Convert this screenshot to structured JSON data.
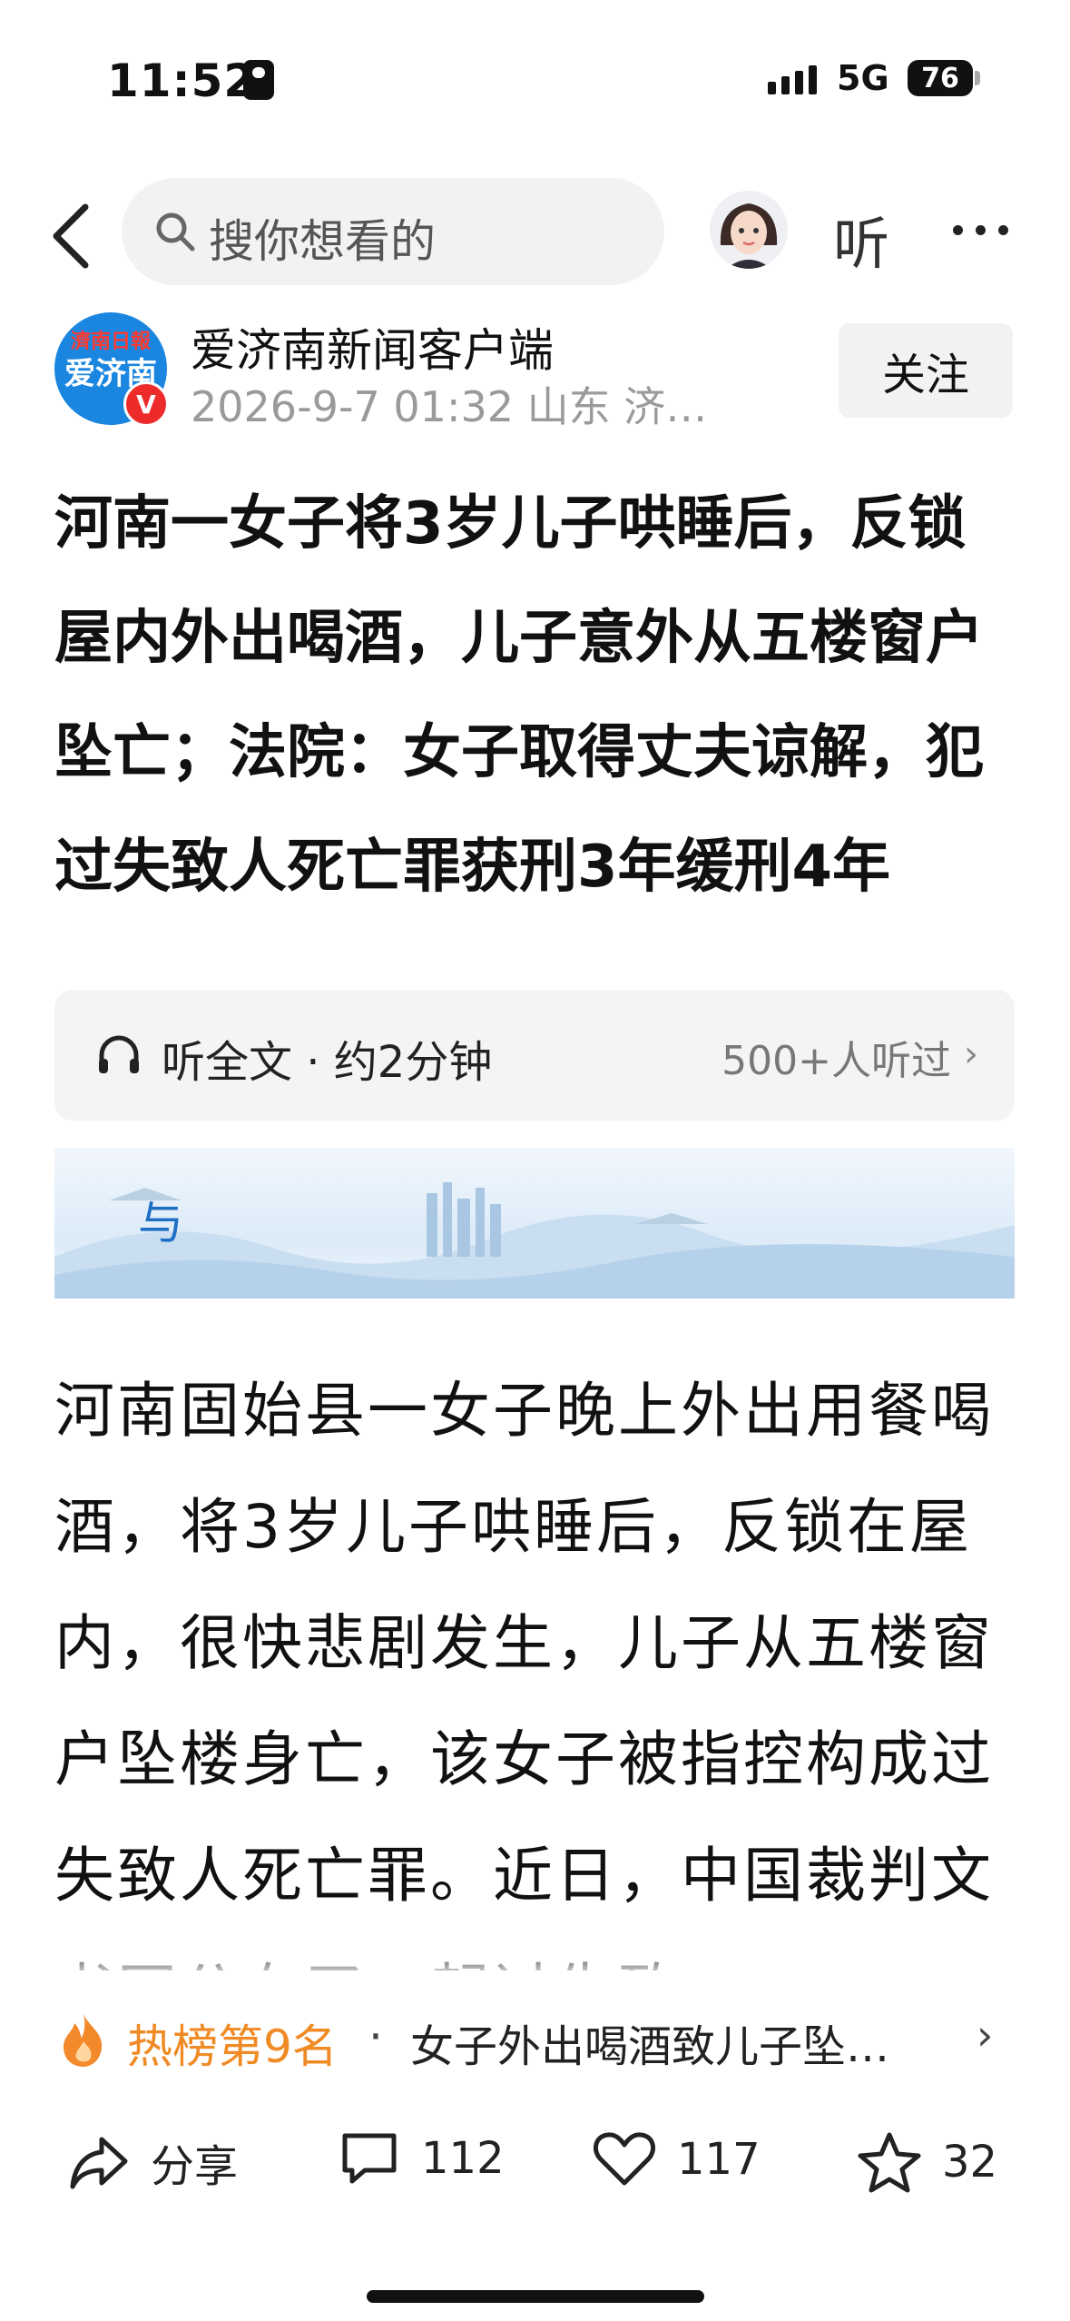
{
  "status_bar": {
    "time": "11:52",
    "network": "5G",
    "battery": "76"
  },
  "search": {
    "placeholder": "搜你想看的"
  },
  "nav": {
    "listen_label": "听"
  },
  "publisher": {
    "name": "爱济南新闻客户端",
    "meta": "2026-9-7 01:32 山东 济…",
    "logo_top": "濟南日報",
    "logo_main": "爱济南",
    "verified_badge": "V",
    "follow_label": "关注"
  },
  "article": {
    "title": "河南一女子将3岁儿子哄睡后，反锁屋内外出喝酒，儿子意外从五楼窗户坠亡；法院：女子取得丈夫谅解，犯过失致人死亡罪获刑3年缓刑4年",
    "body": "河南固始县一女子晚上外出用餐喝酒，将3岁儿子哄睡后，反锁在屋内，很快悲剧发生，儿子从五楼窗户坠楼身亡，该女子被指控构成过失致人死亡罪。近日，中国裁判文书网公布了一起过失致"
  },
  "listen_card": {
    "label": "听全文 · 约2分钟",
    "count": "500+人听过"
  },
  "banner": {
    "text": "与"
  },
  "hot": {
    "rank_label": "热榜第9名",
    "separator": "·",
    "headline": "女子外出喝酒致儿子坠…"
  },
  "actions": {
    "share_label": "分享",
    "comments": "112",
    "likes": "117",
    "favorites": "32"
  },
  "colors": {
    "accent_orange": "#f08a24",
    "brand_blue": "#1a86e0",
    "verified_red": "#ee2b2b"
  }
}
